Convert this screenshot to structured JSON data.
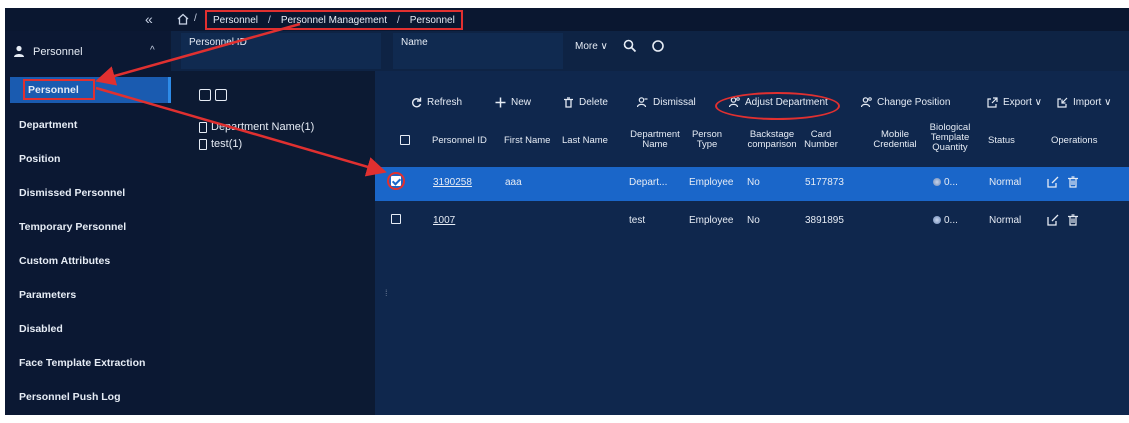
{
  "topbar": {
    "collapse_glyph": "«",
    "home_icon": "home-icon",
    "breadcrumb": [
      "Personnel",
      "Personnel Management",
      "Personnel"
    ],
    "sep": "/"
  },
  "sidebar": {
    "title": "Personnel",
    "caret": "^",
    "items": [
      "Personnel",
      "Department",
      "Position",
      "Dismissed Personnel",
      "Temporary Personnel",
      "Custom Attributes",
      "Parameters",
      "Disabled",
      "Face Template Extraction",
      "Personnel Push Log"
    ]
  },
  "search": {
    "personnel_id_label": "Personnel ID",
    "name_label": "Name",
    "more_label": "More ∨"
  },
  "tree": {
    "nodes": [
      "Department Name(1)",
      "test(1)"
    ]
  },
  "toolbar": {
    "refresh": "Refresh",
    "new": "New",
    "delete": "Delete",
    "dismissal": "Dismissal",
    "adjust_department": "Adjust Department",
    "change_position": "Change Position",
    "export": "Export ∨",
    "import": "Import ∨"
  },
  "table": {
    "headers": {
      "personnel_id": "Personnel ID",
      "first_name": "First Name",
      "last_name": "Last Name",
      "department_name": "Department Name",
      "person_type": "Person Type",
      "backstage": "Backstage comparison",
      "card_number": "Card Number",
      "mobile_credential": "Mobile Credential",
      "biological": "Biological Template Quantity",
      "status": "Status",
      "operations": "Operations"
    },
    "rows": [
      {
        "personnel_id": "3190258",
        "first_name": "aaa",
        "department": "Depart...",
        "person_type": "Employee",
        "backstage": "No",
        "card_number": "5177873",
        "bio": "0...",
        "status": "Normal",
        "checked": true
      },
      {
        "personnel_id": "1007",
        "first_name": "",
        "department": "test",
        "person_type": "Employee",
        "backstage": "No",
        "card_number": "3891895",
        "bio": "0...",
        "status": "Normal",
        "checked": false
      }
    ]
  },
  "colors": {
    "background": "#0c1a33",
    "selected_row": "#1a66c9",
    "active_nav": "#1a5bb0",
    "annotation": "#e03030"
  }
}
